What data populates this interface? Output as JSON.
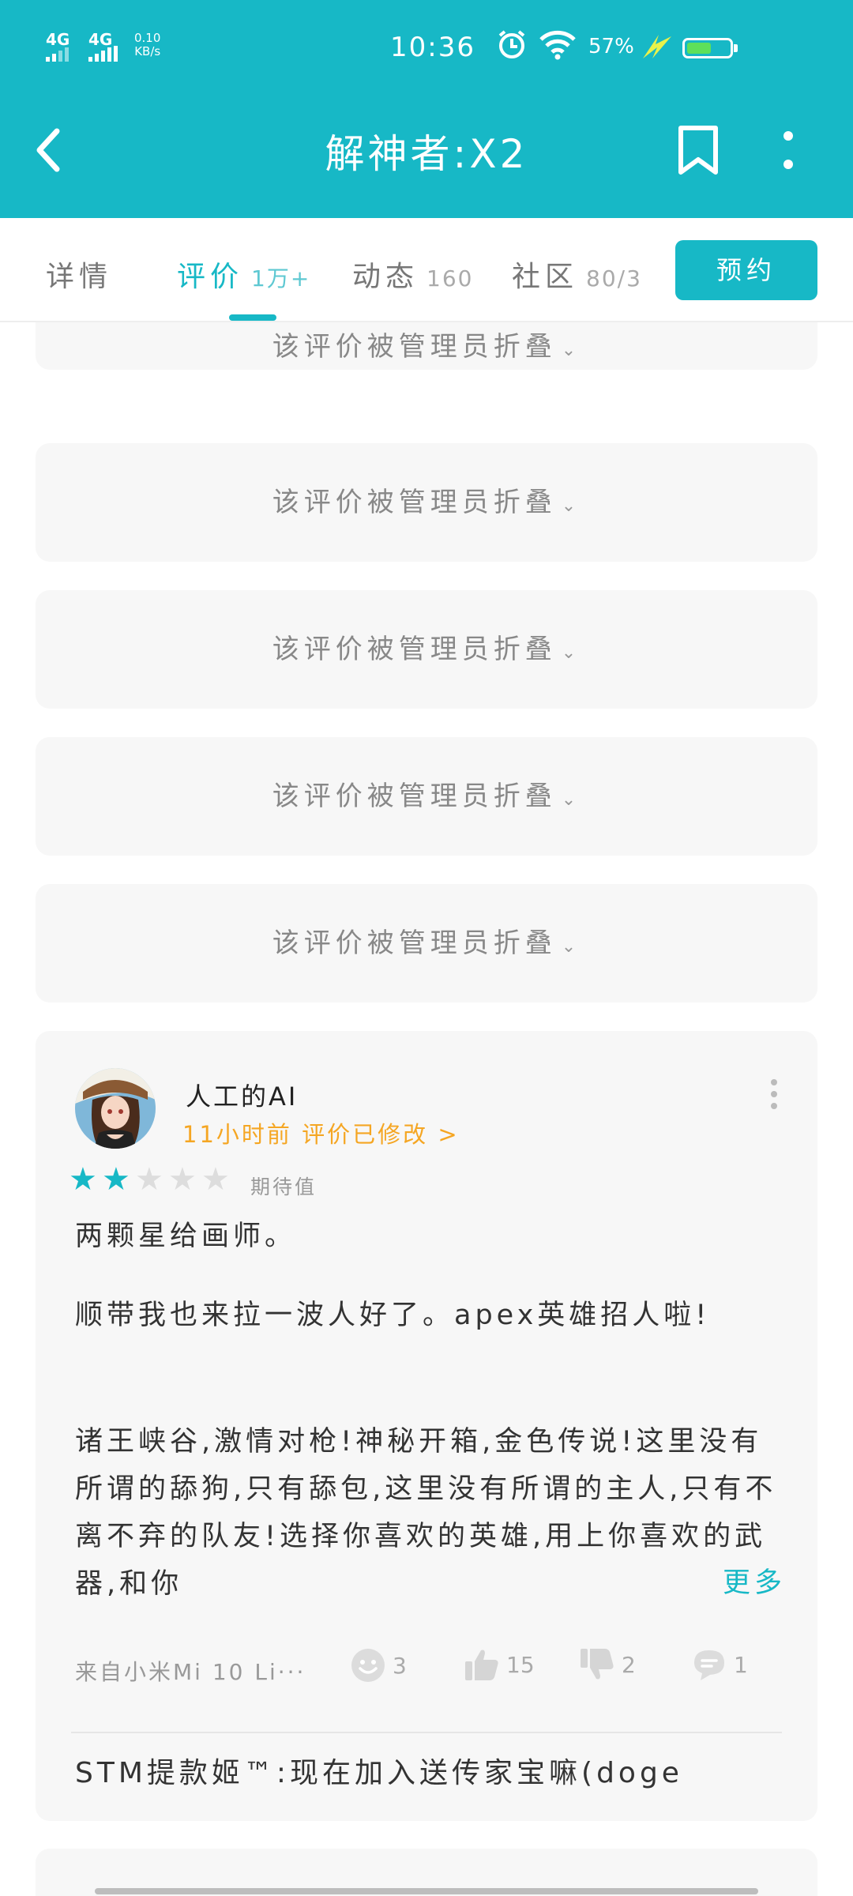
{
  "status_bar": {
    "signal_1": "4G",
    "signal_2": "4G",
    "net_speed_value": "0.10",
    "net_speed_unit": "KB/s",
    "time": "10:36",
    "battery_pct": "57%",
    "battery_level": 0.57
  },
  "app_bar": {
    "title": "解神者:X2",
    "back_icon": "back-icon",
    "bookmark_icon": "bookmark-icon",
    "more_icon": "more-vert-icon"
  },
  "tabs": [
    {
      "label": "详情",
      "count": ""
    },
    {
      "label": "评价",
      "count": "1万+"
    },
    {
      "label": "动态",
      "count": "160"
    },
    {
      "label": "社区",
      "count": "80/3"
    }
  ],
  "active_tab": 1,
  "reserve_button": "预约",
  "folded_label": "该评价被管理员折叠",
  "review": {
    "user": "人工的AI",
    "meta": "11小时前 评价已修改 >",
    "rating": 2,
    "rating_max": 5,
    "rating_label": "期待值",
    "paragraph_1": "两颗星给画师。",
    "paragraph_2": "顺带我也来拉一波人好了。apex英雄招人啦!",
    "paragraph_3": "诸王峡谷,激情对枪!神秘开箱,金色传说!这里没有所谓的舔狗,只有舔包,这里没有所谓的主人,只有不离不弃的队友!选择你喜欢的英雄,用上你喜欢的武器,和你",
    "read_more": "更多",
    "device": "来自小米Mi 10 Li···",
    "funny_count": "3",
    "like_count": "15",
    "dislike_count": "2",
    "comment_count": "1",
    "reply_user": "STM提款姬™",
    "reply_text": ":现在加入送传家宝嘛(doge"
  },
  "colors": {
    "accent": "#17b8c6",
    "meta_orange": "#f5a623",
    "card_bg": "#f7f7f7"
  }
}
